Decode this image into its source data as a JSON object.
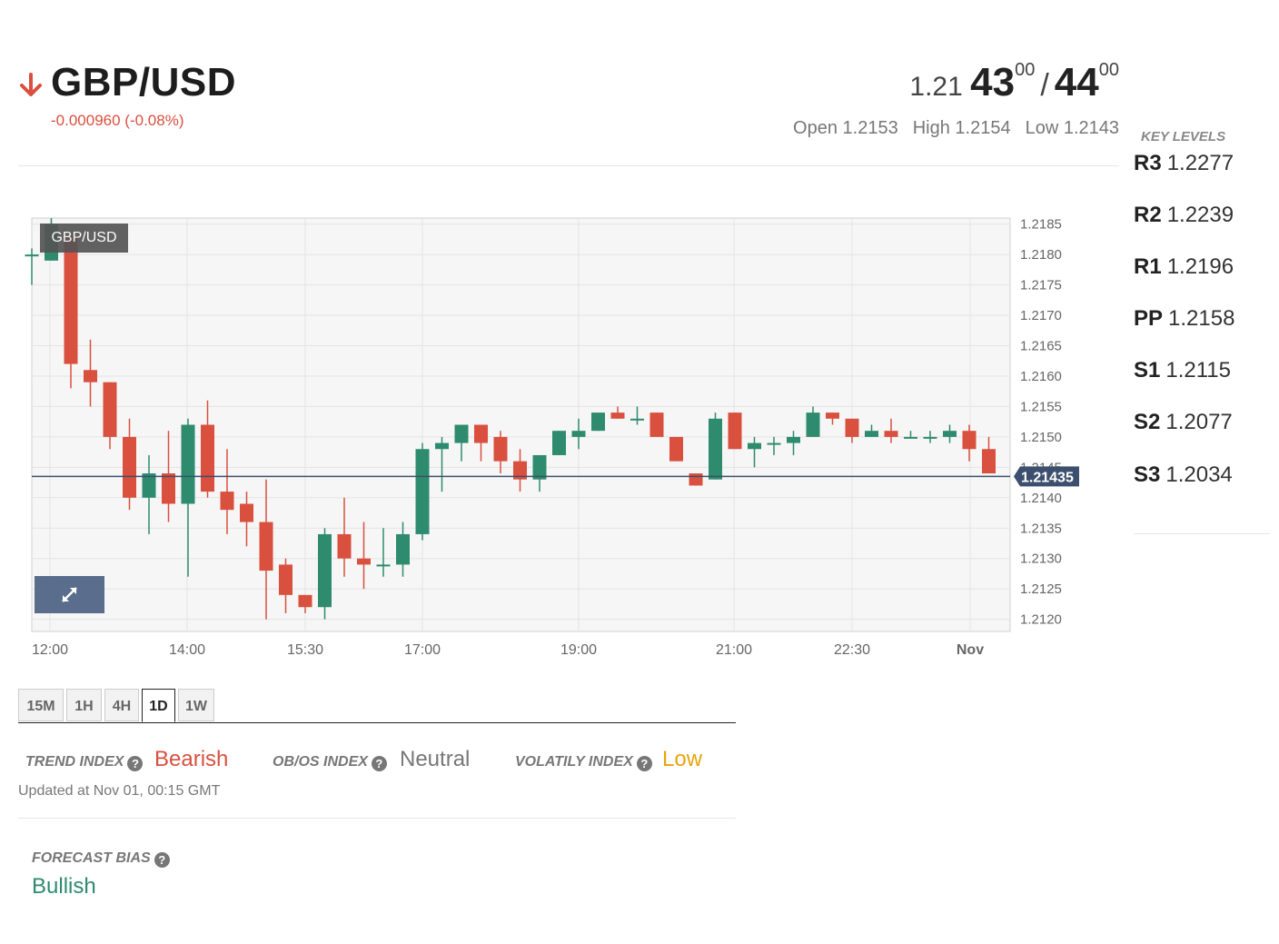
{
  "header": {
    "pair": "GBP/USD",
    "direction": "down",
    "change": "-0.000960 (-0.08%)",
    "quote": {
      "bid_prefix": "1.21",
      "bid_big": "43",
      "bid_pip": "00",
      "separator": "/",
      "ask_big": "44",
      "ask_pip": "00"
    },
    "open": "Open 1.2153",
    "high": "High 1.2154",
    "low": "Low 1.2143"
  },
  "key_levels": {
    "title": "KEY LEVELS",
    "items": [
      {
        "name": "R3",
        "value": "1.2277"
      },
      {
        "name": "R2",
        "value": "1.2239"
      },
      {
        "name": "R1",
        "value": "1.2196"
      },
      {
        "name": "PP",
        "value": "1.2158"
      },
      {
        "name": "S1",
        "value": "1.2115"
      },
      {
        "name": "S2",
        "value": "1.2077"
      },
      {
        "name": "S3",
        "value": "1.2034"
      }
    ]
  },
  "chart": {
    "symbol_label": "GBP/USD",
    "current_price_label": "1.21435",
    "expand_icon": "expand-arrows-icon"
  },
  "chart_data": {
    "type": "candlestick",
    "ylim": [
      1.2118,
      1.2186
    ],
    "y_ticks": [
      "1.2185",
      "1.2180",
      "1.2175",
      "1.2170",
      "1.2165",
      "1.2160",
      "1.2155",
      "1.2150",
      "1.2145",
      "1.2140",
      "1.2135",
      "1.2130",
      "1.2125",
      "1.2120"
    ],
    "x_ticks": [
      "12:00",
      "14:00",
      "15:30",
      "17:00",
      "19:00",
      "21:00",
      "22:30",
      "Nov"
    ],
    "current_price": 1.21435,
    "colors": {
      "up": "#2e8b6e",
      "down": "#d9503f",
      "price_line": "#3c4f6e"
    },
    "candles": [
      {
        "o": 1.218,
        "h": 1.2181,
        "l": 1.2175,
        "c": 1.218
      },
      {
        "o": 1.2179,
        "h": 1.2186,
        "l": 1.2179,
        "c": 1.2185
      },
      {
        "o": 1.2183,
        "h": 1.2183,
        "l": 1.2158,
        "c": 1.2162
      },
      {
        "o": 1.2161,
        "h": 1.2166,
        "l": 1.2155,
        "c": 1.2159
      },
      {
        "o": 1.2159,
        "h": 1.2159,
        "l": 1.2148,
        "c": 1.215
      },
      {
        "o": 1.215,
        "h": 1.2153,
        "l": 1.2138,
        "c": 1.214
      },
      {
        "o": 1.214,
        "h": 1.2147,
        "l": 1.2134,
        "c": 1.2144
      },
      {
        "o": 1.2144,
        "h": 1.2151,
        "l": 1.2136,
        "c": 1.2139
      },
      {
        "o": 1.2139,
        "h": 1.2153,
        "l": 1.2127,
        "c": 1.2152
      },
      {
        "o": 1.2152,
        "h": 1.2156,
        "l": 1.214,
        "c": 1.2141
      },
      {
        "o": 1.2141,
        "h": 1.2148,
        "l": 1.2134,
        "c": 1.2138
      },
      {
        "o": 1.2139,
        "h": 1.2141,
        "l": 1.2132,
        "c": 1.2136
      },
      {
        "o": 1.2136,
        "h": 1.2143,
        "l": 1.212,
        "c": 1.2128
      },
      {
        "o": 1.2129,
        "h": 1.213,
        "l": 1.2121,
        "c": 1.2124
      },
      {
        "o": 1.2124,
        "h": 1.2124,
        "l": 1.2121,
        "c": 1.2122
      },
      {
        "o": 1.2122,
        "h": 1.2135,
        "l": 1.212,
        "c": 1.2134
      },
      {
        "o": 1.2134,
        "h": 1.214,
        "l": 1.2127,
        "c": 1.213
      },
      {
        "o": 1.213,
        "h": 1.2136,
        "l": 1.2125,
        "c": 1.2129
      },
      {
        "o": 1.2129,
        "h": 1.2135,
        "l": 1.2127,
        "c": 1.2129
      },
      {
        "o": 1.2129,
        "h": 1.2136,
        "l": 1.2127,
        "c": 1.2134
      },
      {
        "o": 1.2134,
        "h": 1.2149,
        "l": 1.2133,
        "c": 1.2148
      },
      {
        "o": 1.2148,
        "h": 1.215,
        "l": 1.2141,
        "c": 1.2149
      },
      {
        "o": 1.2149,
        "h": 1.2152,
        "l": 1.2146,
        "c": 1.2152
      },
      {
        "o": 1.2152,
        "h": 1.2152,
        "l": 1.2146,
        "c": 1.2149
      },
      {
        "o": 1.215,
        "h": 1.2151,
        "l": 1.2144,
        "c": 1.2146
      },
      {
        "o": 1.2146,
        "h": 1.2148,
        "l": 1.2141,
        "c": 1.2143
      },
      {
        "o": 1.2143,
        "h": 1.2147,
        "l": 1.2141,
        "c": 1.2147
      },
      {
        "o": 1.2147,
        "h": 1.2151,
        "l": 1.2147,
        "c": 1.2151
      },
      {
        "o": 1.215,
        "h": 1.2153,
        "l": 1.2148,
        "c": 1.2151
      },
      {
        "o": 1.2151,
        "h": 1.2154,
        "l": 1.2151,
        "c": 1.2154
      },
      {
        "o": 1.2154,
        "h": 1.2155,
        "l": 1.2153,
        "c": 1.2153
      },
      {
        "o": 1.2153,
        "h": 1.2155,
        "l": 1.2152,
        "c": 1.2153
      },
      {
        "o": 1.2154,
        "h": 1.2154,
        "l": 1.215,
        "c": 1.215
      },
      {
        "o": 1.215,
        "h": 1.215,
        "l": 1.2146,
        "c": 1.2146
      },
      {
        "o": 1.2144,
        "h": 1.2144,
        "l": 1.2142,
        "c": 1.2142
      },
      {
        "o": 1.2143,
        "h": 1.2154,
        "l": 1.2143,
        "c": 1.2153
      },
      {
        "o": 1.2154,
        "h": 1.2154,
        "l": 1.2148,
        "c": 1.2148
      },
      {
        "o": 1.2148,
        "h": 1.215,
        "l": 1.2145,
        "c": 1.2149
      },
      {
        "o": 1.2149,
        "h": 1.215,
        "l": 1.2147,
        "c": 1.2149
      },
      {
        "o": 1.2149,
        "h": 1.2151,
        "l": 1.2147,
        "c": 1.215
      },
      {
        "o": 1.215,
        "h": 1.2155,
        "l": 1.215,
        "c": 1.2154
      },
      {
        "o": 1.2154,
        "h": 1.2154,
        "l": 1.2152,
        "c": 1.2153
      },
      {
        "o": 1.2153,
        "h": 1.2153,
        "l": 1.2149,
        "c": 1.215
      },
      {
        "o": 1.215,
        "h": 1.2152,
        "l": 1.215,
        "c": 1.2151
      },
      {
        "o": 1.2151,
        "h": 1.2153,
        "l": 1.2149,
        "c": 1.215
      },
      {
        "o": 1.215,
        "h": 1.2151,
        "l": 1.215,
        "c": 1.215
      },
      {
        "o": 1.215,
        "h": 1.2151,
        "l": 1.2149,
        "c": 1.215
      },
      {
        "o": 1.215,
        "h": 1.2152,
        "l": 1.2149,
        "c": 1.2151
      },
      {
        "o": 1.2151,
        "h": 1.2152,
        "l": 1.2146,
        "c": 1.2148
      },
      {
        "o": 1.2148,
        "h": 1.215,
        "l": 1.2144,
        "c": 1.2144
      }
    ]
  },
  "timeframes": {
    "items": [
      "15M",
      "1H",
      "4H",
      "1D",
      "1W"
    ],
    "active": "1D"
  },
  "indexes": {
    "trend": {
      "label": "TREND INDEX",
      "value": "Bearish",
      "color": "#d9503f"
    },
    "obos": {
      "label": "OB/OS INDEX",
      "value": "Neutral",
      "color": "#777777"
    },
    "volatility": {
      "label": "VOLATILY INDEX",
      "value": "Low",
      "color": "#e8a40c"
    },
    "help_glyph": "?",
    "updated": "Updated at Nov 01, 00:15 GMT"
  },
  "forecast": {
    "label": "FORECAST BIAS",
    "value": "Bullish",
    "color": "#2e8b6e"
  }
}
